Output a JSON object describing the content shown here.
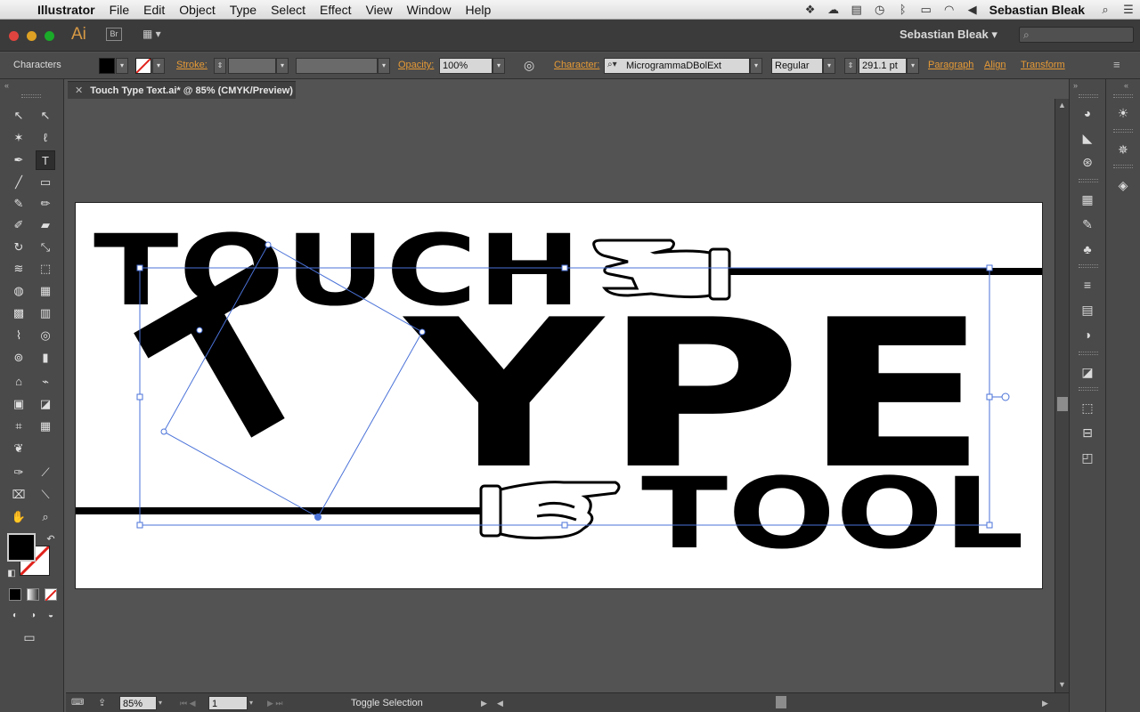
{
  "menubar": {
    "app_name": "Illustrator",
    "items": [
      "File",
      "Edit",
      "Object",
      "Type",
      "Select",
      "Effect",
      "View",
      "Window",
      "Help"
    ],
    "user_name": "Sebastian Bleak",
    "tray_icons": [
      "dropbox-icon",
      "creative-cloud-icon",
      "battery-monitor-icon",
      "time-machine-icon",
      "bluetooth-icon",
      "battery-icon",
      "wifi-icon",
      "volume-icon"
    ]
  },
  "appbar": {
    "logo": "Ai",
    "bridge_label": "Br",
    "workspace": "Sebastian Bleak"
  },
  "controlbar": {
    "panel_name": "Characters",
    "stroke_label": "Stroke:",
    "opacity_label": "Opacity:",
    "opacity_value": "100%",
    "character_label": "Character:",
    "font_name": "MicrogrammaDBolExt",
    "font_style": "Regular",
    "font_size": "291.1 pt",
    "paragraph_label": "Paragraph",
    "align_label": "Align",
    "transform_label": "Transform"
  },
  "document": {
    "tab_title": "Touch Type Text.ai* @ 85% (CMYK/Preview)"
  },
  "artwork": {
    "line1": "TOUCH",
    "line2_big_letter": "T",
    "line2_rest": "YPE",
    "line3": "TOOL"
  },
  "statusbar": {
    "zoom": "85%",
    "page": "1",
    "status_text": "Toggle Selection"
  },
  "colors": {
    "accent_orange": "#e69a36",
    "selection_blue": "#4a72d8",
    "ui_dark": "#4a4a4a"
  }
}
